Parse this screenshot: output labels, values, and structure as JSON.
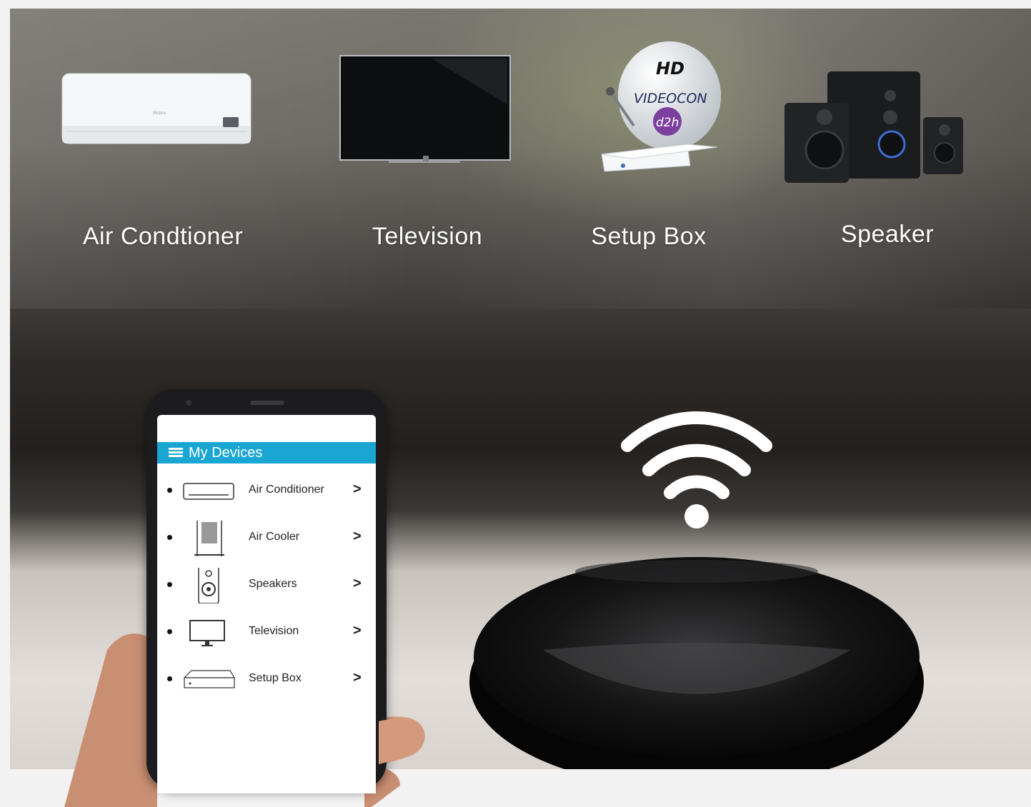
{
  "devices": [
    {
      "label": "Air Condtioner",
      "icon": "air-conditioner-image"
    },
    {
      "label": "Television",
      "icon": "television-image"
    },
    {
      "label": "Setup Box",
      "icon": "setup-box-dish-image"
    },
    {
      "label": "Speaker",
      "icon": "speaker-system-image"
    }
  ],
  "dish_brand": {
    "top": "HD",
    "name": "VIDEOCON",
    "sub": "d2h"
  },
  "phone": {
    "title": "My Devices",
    "menu_icon": "hamburger-menu-icon",
    "items": [
      {
        "label": "Air Conditioner",
        "icon": "air-conditioner-icon",
        "chevron": ">"
      },
      {
        "label": "Air Cooler",
        "icon": "air-cooler-icon",
        "chevron": ">"
      },
      {
        "label": "Speakers",
        "icon": "speaker-icon",
        "chevron": ">"
      },
      {
        "label": "Television",
        "icon": "tv-icon",
        "chevron": ">"
      },
      {
        "label": "Setup Box",
        "icon": "setup-box-icon",
        "chevron": ">"
      }
    ]
  },
  "colors": {
    "app_bar": "#1aa6d3",
    "hub": "#0c0c0c",
    "label_text": "#ffffff"
  },
  "hub_icon": "wifi-icon"
}
